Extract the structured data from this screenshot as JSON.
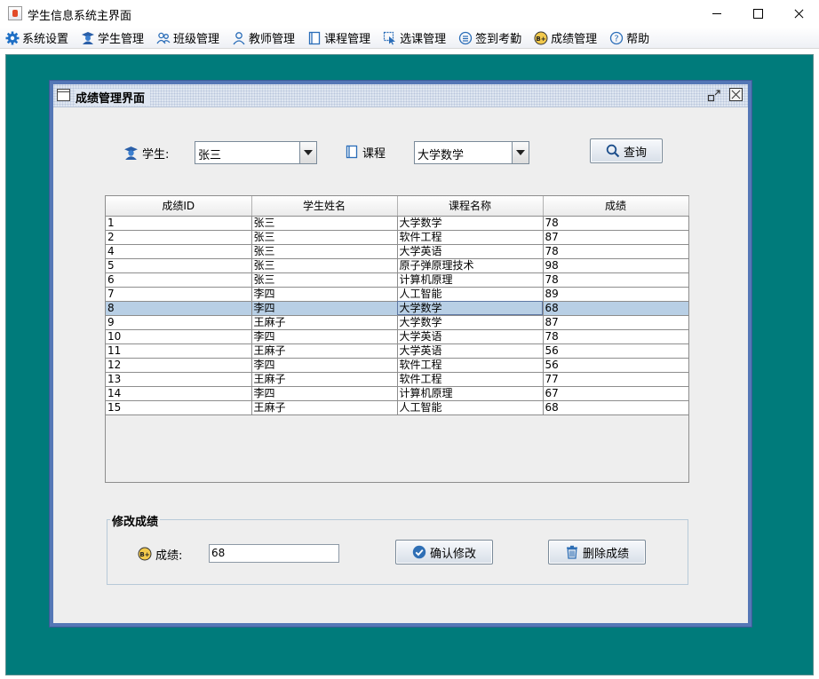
{
  "window": {
    "title": "学生信息系统主界面"
  },
  "menu": [
    {
      "label": "系统设置",
      "icon": "gear-icon"
    },
    {
      "label": "学生管理",
      "icon": "student-icon"
    },
    {
      "label": "班级管理",
      "icon": "class-icon"
    },
    {
      "label": "教师管理",
      "icon": "teacher-icon"
    },
    {
      "label": "课程管理",
      "icon": "course-icon"
    },
    {
      "label": "选课管理",
      "icon": "select-course-icon"
    },
    {
      "label": "签到考勤",
      "icon": "attendance-icon"
    },
    {
      "label": "成绩管理",
      "icon": "grade-icon"
    },
    {
      "label": "帮助",
      "icon": "help-icon"
    }
  ],
  "frame": {
    "title": "成绩管理界面"
  },
  "filter": {
    "student_label": "学生:",
    "student_value": "张三",
    "course_label": "课程",
    "course_value": "大学数学",
    "query_label": "查询"
  },
  "table": {
    "columns": [
      "成绩ID",
      "学生姓名",
      "课程名称",
      "成绩"
    ],
    "rows": [
      [
        "1",
        "张三",
        "大学数学",
        "78"
      ],
      [
        "2",
        "张三",
        "软件工程",
        "87"
      ],
      [
        "4",
        "张三",
        "大学英语",
        "78"
      ],
      [
        "5",
        "张三",
        "原子弹原理技术",
        "98"
      ],
      [
        "6",
        "张三",
        "计算机原理",
        "78"
      ],
      [
        "7",
        "李四",
        "人工智能",
        "89"
      ],
      [
        "8",
        "李四",
        "大学数学",
        "68"
      ],
      [
        "9",
        "王麻子",
        "大学数学",
        "87"
      ],
      [
        "10",
        "李四",
        "大学英语",
        "78"
      ],
      [
        "11",
        "王麻子",
        "大学英语",
        "56"
      ],
      [
        "12",
        "李四",
        "软件工程",
        "56"
      ],
      [
        "13",
        "王麻子",
        "软件工程",
        "77"
      ],
      [
        "14",
        "李四",
        "计算机原理",
        "67"
      ],
      [
        "15",
        "王麻子",
        "人工智能",
        "68"
      ]
    ],
    "selected_row": 6
  },
  "edit": {
    "legend": "修改成绩",
    "score_label": "成绩:",
    "score_value": "68",
    "confirm_label": "确认修改",
    "delete_label": "删除成绩"
  },
  "colors": {
    "desktop": "#007b7b",
    "frame_border": "#5577b6",
    "selection": "#b8cfe5"
  }
}
